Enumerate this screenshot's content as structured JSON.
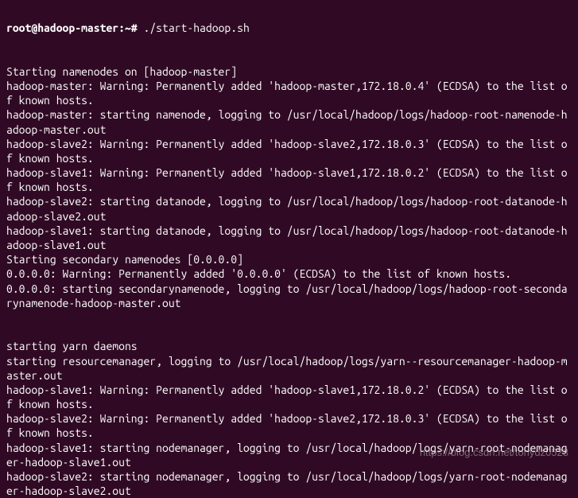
{
  "prompt": {
    "user": "root@hadoop-master",
    "path": "~",
    "symbol": "#",
    "command": "./start-hadoop.sh"
  },
  "blank1": "",
  "blank2": "",
  "lines": [
    "Starting namenodes on [hadoop-master]",
    "hadoop-master: Warning: Permanently added 'hadoop-master,172.18.0.4' (ECDSA) to the list of known hosts.",
    "hadoop-master: starting namenode, logging to /usr/local/hadoop/logs/hadoop-root-namenode-hadoop-master.out",
    "hadoop-slave2: Warning: Permanently added 'hadoop-slave2,172.18.0.3' (ECDSA) to the list of known hosts.",
    "hadoop-slave1: Warning: Permanently added 'hadoop-slave1,172.18.0.2' (ECDSA) to the list of known hosts.",
    "hadoop-slave2: starting datanode, logging to /usr/local/hadoop/logs/hadoop-root-datanode-hadoop-slave2.out",
    "hadoop-slave1: starting datanode, logging to /usr/local/hadoop/logs/hadoop-root-datanode-hadoop-slave1.out",
    "Starting secondary namenodes [0.0.0.0]",
    "0.0.0.0: Warning: Permanently added '0.0.0.0' (ECDSA) to the list of known hosts.",
    "0.0.0.0: starting secondarynamenode, logging to /usr/local/hadoop/logs/hadoop-root-secondarynamenode-hadoop-master.out"
  ],
  "blank3": "",
  "blank4": "",
  "lines2": [
    "starting yarn daemons",
    "starting resourcemanager, logging to /usr/local/hadoop/logs/yarn--resourcemanager-hadoop-master.out",
    "hadoop-slave1: Warning: Permanently added 'hadoop-slave1,172.18.0.2' (ECDSA) to the list of known hosts.",
    "hadoop-slave2: Warning: Permanently added 'hadoop-slave2,172.18.0.3' (ECDSA) to the list of known hosts.",
    "hadoop-slave1: starting nodemanager, logging to /usr/local/hadoop/logs/yarn-root-nodemanager-hadoop-slave1.out",
    "hadoop-slave2: starting nodemanager, logging to /usr/local/hadoop/logs/yarn-root-nodemanager-hadoop-slave2.out"
  ],
  "watermark": "https://blog.csdn.net/tonydz0523"
}
